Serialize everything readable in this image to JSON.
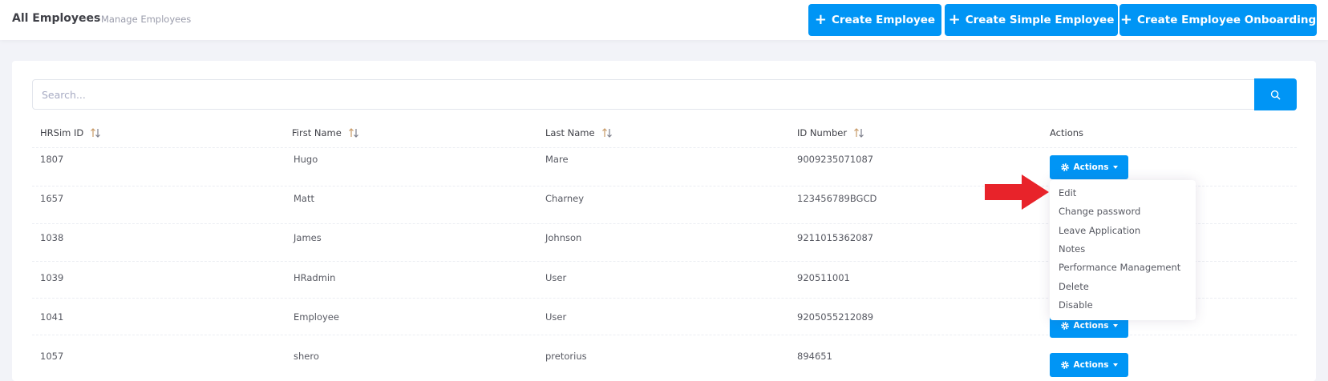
{
  "header": {
    "title": "All Employees",
    "breadcrumb": "Manage Employees",
    "buttons": [
      {
        "label": "Create Employee",
        "icon": "plus-icon"
      },
      {
        "label": "Create Simple Employee",
        "icon": "plus-icon"
      },
      {
        "label": "Create Employee Onboarding",
        "icon": "plus-icon"
      }
    ]
  },
  "search": {
    "placeholder": "Search...",
    "value": "",
    "button_icon": "search-icon"
  },
  "table": {
    "columns": [
      {
        "label": "HRSim ID",
        "sortable": true
      },
      {
        "label": "First Name",
        "sortable": true
      },
      {
        "label": "Last Name",
        "sortable": true
      },
      {
        "label": "ID Number",
        "sortable": true
      },
      {
        "label": "Actions",
        "sortable": false
      }
    ],
    "rows": [
      {
        "id": "1807",
        "first": "Hugo",
        "last": "Mare",
        "id_number": "9009235071087"
      },
      {
        "id": "1657",
        "first": "Matt",
        "last": "Charney",
        "id_number": "123456789BGCD"
      },
      {
        "id": "1038",
        "first": "James",
        "last": "Johnson",
        "id_number": "9211015362087"
      },
      {
        "id": "1039",
        "first": "HRadmin",
        "last": "User",
        "id_number": "920511001"
      },
      {
        "id": "1041",
        "first": "Employee",
        "last": "User",
        "id_number": "9205055212089"
      },
      {
        "id": "1057",
        "first": "shero",
        "last": "pretorius",
        "id_number": "894651"
      }
    ],
    "actions_label": "Actions"
  },
  "dropdown": {
    "open_on_row": 0,
    "items": [
      "Edit",
      "Change password",
      "Leave Application",
      "Notes",
      "Performance Management",
      "Delete",
      "Disable"
    ]
  },
  "annotation": {
    "icon": "red-arrow-icon",
    "color": "#e8232a"
  },
  "colors": {
    "accent": "#0095f5",
    "background": "#f2f3f8"
  }
}
